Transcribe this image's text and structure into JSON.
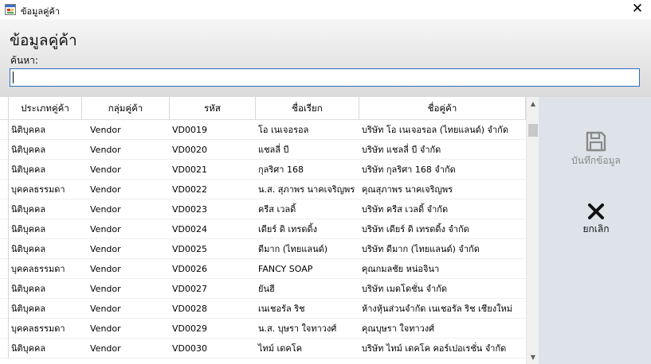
{
  "window": {
    "title": "ข้อมูลคู่ค้า",
    "close_glyph": "✕"
  },
  "page": {
    "title": "ข้อมูลคู่ค้า",
    "search_label": "ค้นหา:",
    "search_value": ""
  },
  "table": {
    "columns": [
      "ประเภทคู่ค้า",
      "กลุ่มคู่ค้า",
      "รหัส",
      "ชื่อเรียก",
      "ชื่อคู่ค้า"
    ],
    "rows": [
      [
        "นิติบุคคล",
        "Vendor",
        "VD0019",
        "โอ เนเจอรอล",
        "บริษัท โอ เนเจอรอล (ไทยแลนด์) จำกัด"
      ],
      [
        "นิติบุคคล",
        "Vendor",
        "VD0020",
        "แชลลี่ บี",
        "บริษัท แชลลี่ บี จำกัด"
      ],
      [
        "นิติบุคคล",
        "Vendor",
        "VD0021",
        "กุลริศา 168",
        "บริษัท กุลริศา 168 จำกัด"
      ],
      [
        "บุคคลธรรมดา",
        "Vendor",
        "VD0022",
        "น.ส. สุภาพร นาคเจริญพร",
        "คุณสุภาพร นาคเจริญพร"
      ],
      [
        "นิติบุคคล",
        "Vendor",
        "VD0023",
        "ครีส เวลดิ้",
        "บริษัท ครีส เวลดิ้ จำกัด"
      ],
      [
        "นิติบุคคล",
        "Vendor",
        "VD0024",
        "เดียร์ ดิ เทรดดิ้ง",
        "บริษัท เดียร์ ดิ เทรดดิ้ง จำกัด"
      ],
      [
        "นิติบุคคล",
        "Vendor",
        "VD0025",
        "ดีมาก (ไทยแลนด์)",
        "บริษัท ดีมาก (ไทยแลนด์) จำกัด"
      ],
      [
        "บุคคลธรรมดา",
        "Vendor",
        "VD0026",
        "FANCY SOAP",
        "คุณกมลชัย หน่อจินา"
      ],
      [
        "นิติบุคคล",
        "Vendor",
        "VD0027",
        "ยันฮี",
        "บริษัท เมดโดชั่น จำกัด"
      ],
      [
        "นิติบุคคล",
        "Vendor",
        "VD0028",
        "เนเชอรัล ริช",
        "ห้างหุ้นส่วนจำกัด เนเชอรัล ริช เชียงใหม่"
      ],
      [
        "บุคคลธรรมดา",
        "Vendor",
        "VD0029",
        "น.ส. บุษรา ใจทาวงศ์",
        "คุณบุษรา ใจทาวงศ์"
      ],
      [
        "นิติบุคคล",
        "Vendor",
        "VD0030",
        "ไทม์ เดคโค",
        "บริษัท ไทม์ เดคโค คอร์เปอเรชั่น จำกัด"
      ]
    ]
  },
  "scrollbar": {
    "up_glyph": "▲",
    "down_glyph": "▼"
  },
  "actions": {
    "save": {
      "label": "บันทึกข้อมูล",
      "icon": "floppy-disk-icon",
      "enabled": false
    },
    "cancel": {
      "label": "ยกเลิก",
      "icon": "x-mark-icon",
      "enabled": true
    }
  },
  "colors": {
    "header_bg": "#e6e6e6",
    "side_panel_bg": "#dde3e8",
    "input_border": "#2b6cc4",
    "save_disabled": "#8a8a8a"
  }
}
